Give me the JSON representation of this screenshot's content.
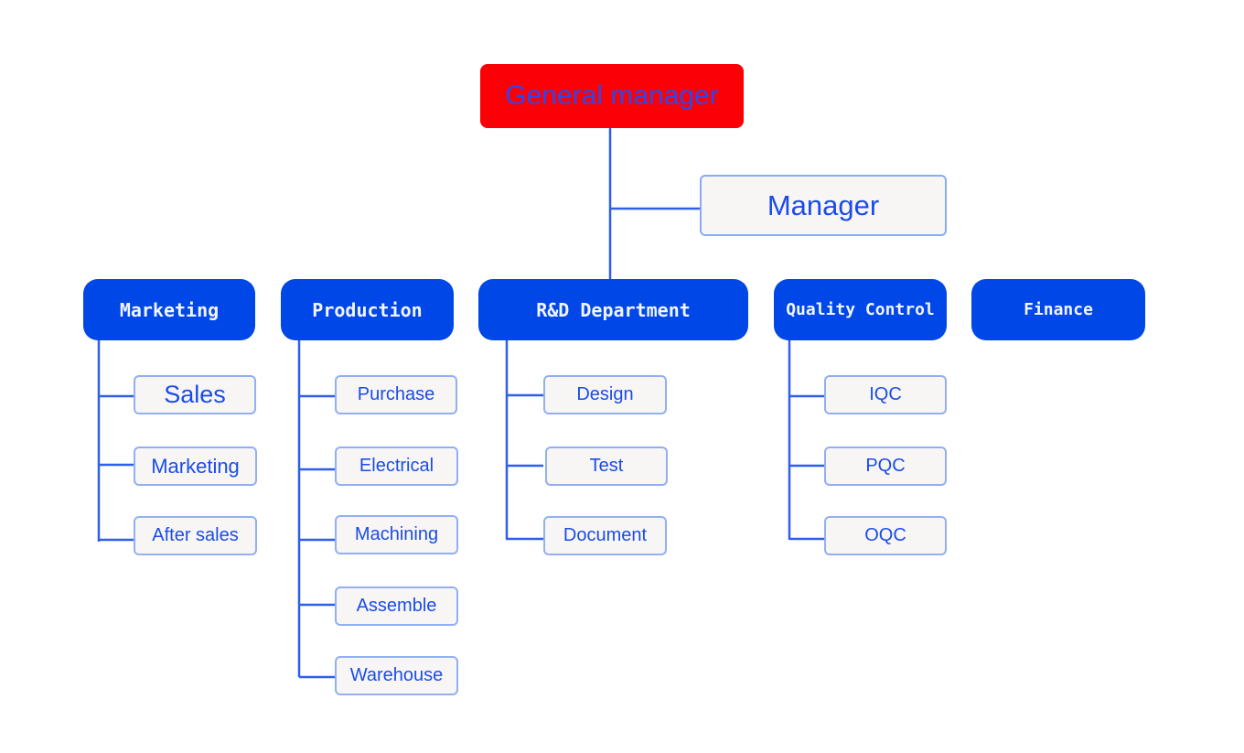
{
  "top": {
    "label": "General manager",
    "color": "#fb0006"
  },
  "assistant": {
    "label": "Manager"
  },
  "departments": [
    {
      "label": "Marketing",
      "children": [
        "Sales",
        "Marketing",
        "After sales"
      ]
    },
    {
      "label": "Production",
      "children": [
        "Purchase",
        "Electrical",
        "Machining",
        "Assemble",
        "Warehouse"
      ]
    },
    {
      "label": "R&D Department",
      "children": [
        "Design",
        "Test",
        "Document"
      ]
    },
    {
      "label": "Quality Control",
      "children": [
        "IQC",
        "PQC",
        "OQC"
      ]
    },
    {
      "label": "Finance",
      "children": []
    }
  ],
  "colors": {
    "department": "#0047e8",
    "line": "#2f5fe8",
    "text": "#1a4ce8"
  }
}
